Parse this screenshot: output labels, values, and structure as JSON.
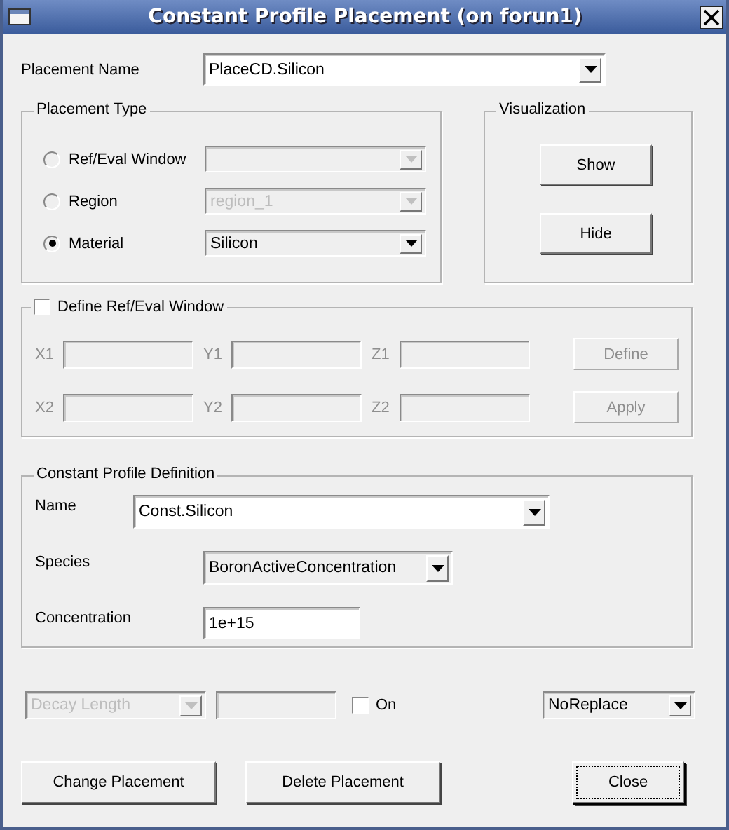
{
  "window": {
    "title": "Constant Profile Placement (on forun1)"
  },
  "placement_name": {
    "label": "Placement Name",
    "dropdown": {
      "value": "PlaceCD.Silicon",
      "editable": true,
      "disabled": false
    }
  },
  "placement_type": {
    "title": "Placement Type",
    "options": [
      {
        "label": "Ref/Eval Window",
        "selected": false,
        "dropdown": {
          "editable": false,
          "disabled": true
        }
      },
      {
        "label": "Region",
        "selected": false,
        "dropdown": {
          "value": "region_1",
          "editable": false,
          "disabled": true
        }
      },
      {
        "label": "Material",
        "selected": true,
        "dropdown": {
          "value": "Silicon",
          "editable": false,
          "disabled": false
        }
      }
    ]
  },
  "visualization": {
    "title": "Visualization",
    "buttons": [
      {
        "label": "Show"
      },
      {
        "label": "Hide"
      }
    ]
  },
  "ref_eval_window": {
    "label": "Define Ref/Eval Window",
    "checked": false,
    "disabled": true,
    "rows": [
      {
        "fields": [
          {
            "label": "X1"
          },
          {
            "label": "Y1"
          },
          {
            "label": "Z1"
          }
        ],
        "button": {
          "label": "Define",
          "disabled": true
        }
      },
      {
        "fields": [
          {
            "label": "X2"
          },
          {
            "label": "Y2"
          },
          {
            "label": "Z2"
          }
        ],
        "button": {
          "label": "Apply",
          "disabled": true
        }
      }
    ]
  },
  "profile_definition": {
    "title": "Constant Profile Definition",
    "name": {
      "label": "Name",
      "dropdown": {
        "value": "Const.Silicon",
        "editable": true,
        "disabled": false
      }
    },
    "species": {
      "label": "Species",
      "dropdown": {
        "value": "BoronActiveConcentration",
        "editable": false,
        "disabled": false
      }
    },
    "concentration": {
      "label": "Concentration",
      "value": "1e+15"
    }
  },
  "decay": {
    "dropdown": {
      "value": "Decay Length",
      "editable": false,
      "disabled": true
    },
    "length_field": {
      "disabled": true
    },
    "on": {
      "label": "On",
      "checked": false
    }
  },
  "replace": {
    "dropdown": {
      "value": "NoReplace",
      "editable": false,
      "disabled": false
    }
  },
  "buttons": [
    {
      "label": "Change Placement",
      "focused": false
    },
    {
      "label": "Delete Placement",
      "focused": false
    },
    {
      "label": "Close",
      "focused": true
    }
  ]
}
